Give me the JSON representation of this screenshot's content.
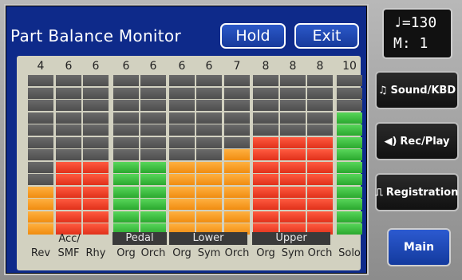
{
  "screen": {
    "title": "Part Balance Monitor",
    "hold_label": "Hold",
    "exit_label": "Exit"
  },
  "meters": {
    "channels": [
      {
        "value": "4",
        "label": "Rev",
        "lit": 4,
        "colors": [
          "y",
          "y",
          "y",
          "y"
        ]
      },
      {
        "value": "6",
        "label": "SMF",
        "lit": 6,
        "colors": [
          "r",
          "r",
          "r",
          "r",
          "r",
          "r"
        ]
      },
      {
        "value": "6",
        "label": "Rhy",
        "lit": 6,
        "colors": [
          "r",
          "r",
          "r",
          "r",
          "r",
          "r"
        ]
      },
      {
        "value": "6",
        "label": "Org",
        "lit": 6,
        "colors": [
          "g",
          "g",
          "g",
          "g",
          "g",
          "g"
        ]
      },
      {
        "value": "6",
        "label": "Orch",
        "lit": 6,
        "colors": [
          "g",
          "g",
          "g",
          "g",
          "g",
          "g"
        ]
      },
      {
        "value": "6",
        "label": "Org",
        "lit": 6,
        "colors": [
          "y",
          "y",
          "y",
          "y",
          "y",
          "y"
        ]
      },
      {
        "value": "6",
        "label": "Sym",
        "lit": 6,
        "colors": [
          "y",
          "y",
          "y",
          "y",
          "y",
          "y"
        ]
      },
      {
        "value": "7",
        "label": "Orch",
        "lit": 7,
        "colors": [
          "y",
          "y",
          "y",
          "y",
          "y",
          "y",
          "y"
        ]
      },
      {
        "value": "8",
        "label": "Org",
        "lit": 8,
        "colors": [
          "r",
          "r",
          "r",
          "r",
          "r",
          "r",
          "r",
          "r"
        ]
      },
      {
        "value": "8",
        "label": "Sym",
        "lit": 8,
        "colors": [
          "r",
          "r",
          "r",
          "r",
          "r",
          "r",
          "r",
          "r"
        ]
      },
      {
        "value": "8",
        "label": "Orch",
        "lit": 8,
        "colors": [
          "r",
          "r",
          "r",
          "r",
          "r",
          "r",
          "r",
          "r"
        ]
      },
      {
        "value": "10",
        "label": "Solo",
        "lit": 10,
        "colors": [
          "g",
          "g",
          "g",
          "g",
          "g",
          "g",
          "g",
          "g",
          "g",
          "g"
        ]
      }
    ],
    "total_segments": 13,
    "acc_label": "Acc/",
    "groups": {
      "pedal": "Pedal",
      "lower": "Lower",
      "upper": "Upper"
    }
  },
  "tempo_display": {
    "tempo": "♩=130",
    "measure": "M:   1"
  },
  "sidebar": {
    "sound_kbd": "Sound/KBD",
    "rec_play": "Rec/Play",
    "registration": "Registration",
    "main": "Main"
  },
  "colors": {
    "screen_bg": "#0e2a8a",
    "panel_bg": "#d2d1c0",
    "yellow": "#f5a020",
    "red": "#ee3a24",
    "green": "#3cc040"
  }
}
